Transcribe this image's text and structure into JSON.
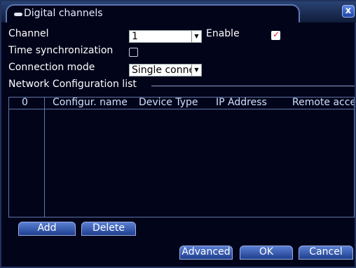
{
  "window": {
    "title": "Digital channels",
    "close_label": "x"
  },
  "form": {
    "channel_label": "Channel",
    "channel_value": "1",
    "enable_label": "Enable",
    "enable_checked": true,
    "time_sync_label": "Time synchronization",
    "time_sync_checked": false,
    "connection_mode_label": "Connection mode",
    "connection_mode_value": "Single conne"
  },
  "network_list": {
    "title": "Network Configuration list",
    "columns": [
      "0",
      "Configur. name",
      "Device Type",
      "IP Address",
      "Remote acce"
    ],
    "rows": []
  },
  "buttons": {
    "add": "Add",
    "delete": "Delete",
    "advanced": "Advanced",
    "ok": "OK",
    "cancel": "Cancel"
  }
}
